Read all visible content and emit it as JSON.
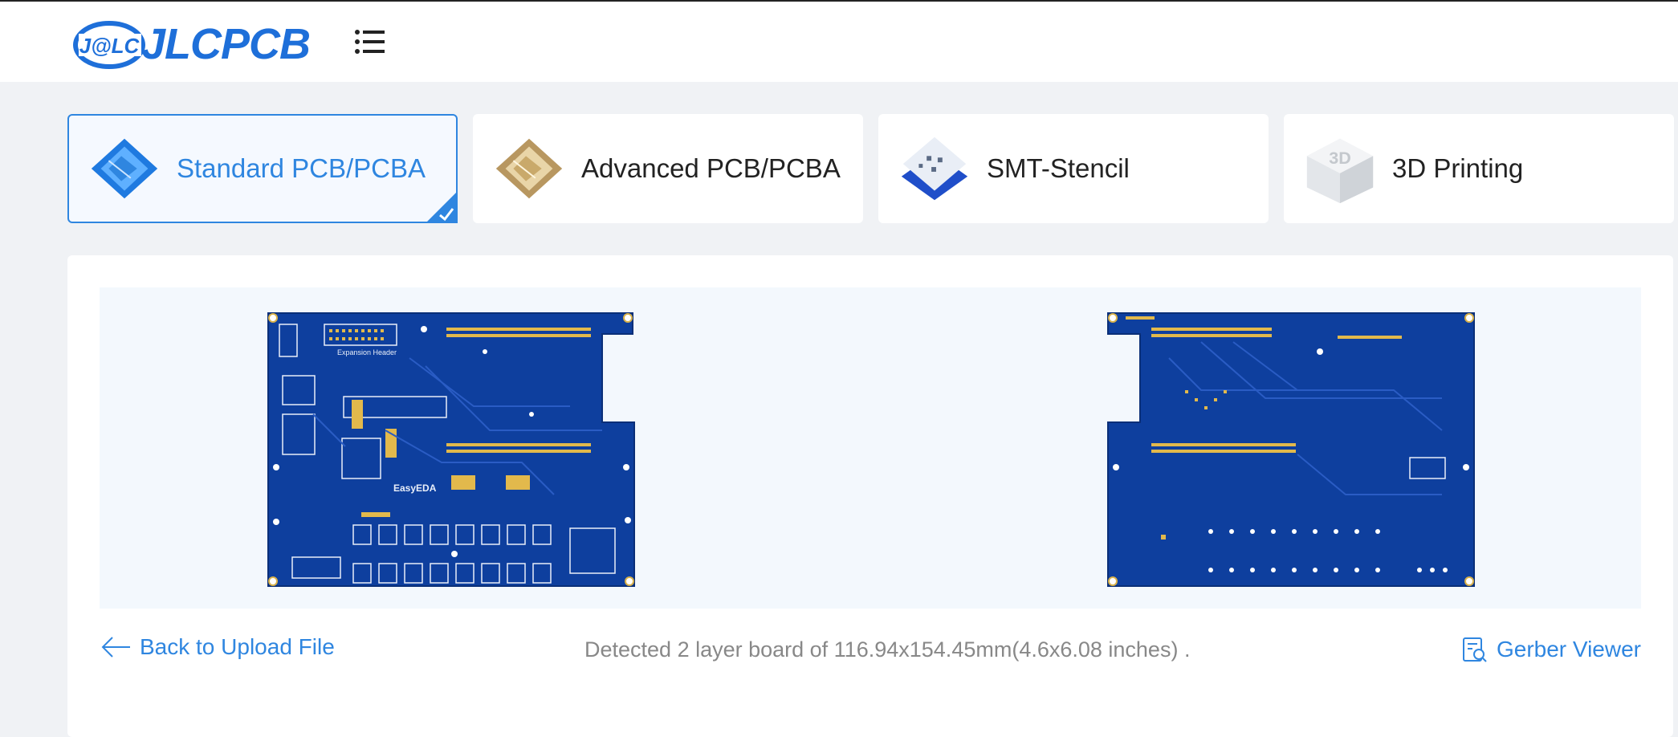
{
  "header": {
    "logo_badge": "J@LC",
    "logo_text": "JLCPCB",
    "brand_color": "#1e6fd9",
    "menu_icon": "list-menu-icon"
  },
  "tabs": [
    {
      "label": "Standard PCB/PCBA",
      "active": true
    },
    {
      "label": "Advanced PCB/PCBA",
      "active": false
    },
    {
      "label": "SMT-Stencil",
      "active": false
    },
    {
      "label": "3D Printing",
      "active": false
    }
  ],
  "preview": {
    "top_board": {
      "silk_labels": [
        "Expansion Header",
        "EasyEDA"
      ]
    },
    "bottom_board": {}
  },
  "footer": {
    "back_label": "Back to Upload File",
    "detected_text": "Detected 2 layer board of 116.94x154.45mm(4.6x6.08 inches) .",
    "gerber_label": "Gerber Viewer"
  },
  "colors": {
    "accent": "#2f86e0",
    "pcb": "#0e3f9e"
  }
}
